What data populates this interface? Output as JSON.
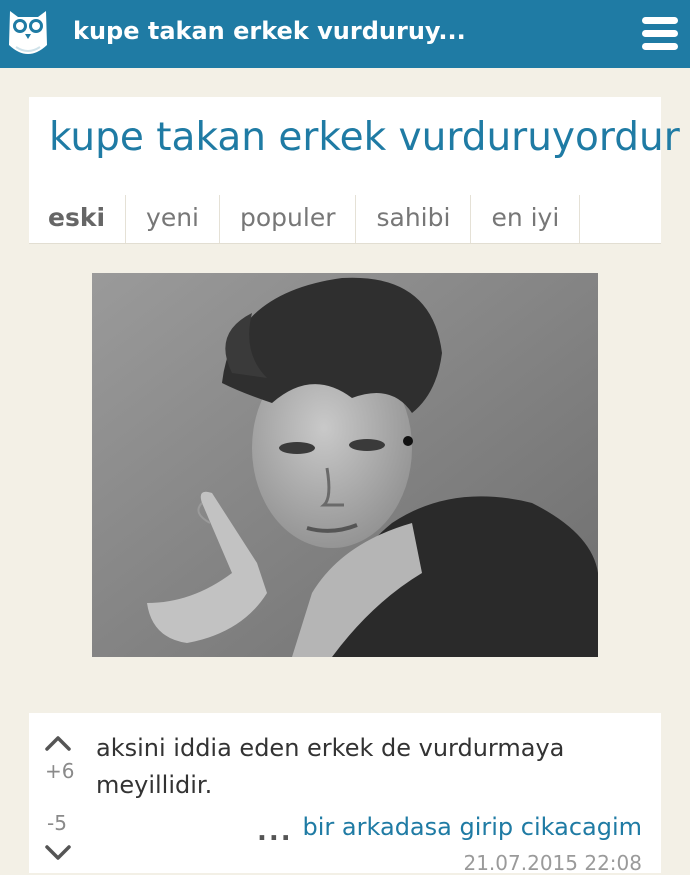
{
  "header": {
    "title": "kupe takan erkek vurduruy...",
    "logo_icon": "owl-logo-icon",
    "menu_icon": "hamburger-menu-icon",
    "bar_color": "#1f7ba4"
  },
  "topic": {
    "title": "kupe takan erkek vurduruyordur",
    "tabs": [
      {
        "label": "eski",
        "active": true
      },
      {
        "label": "yeni",
        "active": false
      },
      {
        "label": "populer",
        "active": false
      },
      {
        "label": "sahibi",
        "active": false
      },
      {
        "label": "en iyi",
        "active": false
      }
    ]
  },
  "entry": {
    "text": "aksini iddia eden erkek de vurdurmaya meyillidir.",
    "upvotes": "+6",
    "downvotes": "-5",
    "more": "...",
    "author": "bir arkadasa girip cikacagim",
    "date": "21.07.2015 22:08"
  }
}
